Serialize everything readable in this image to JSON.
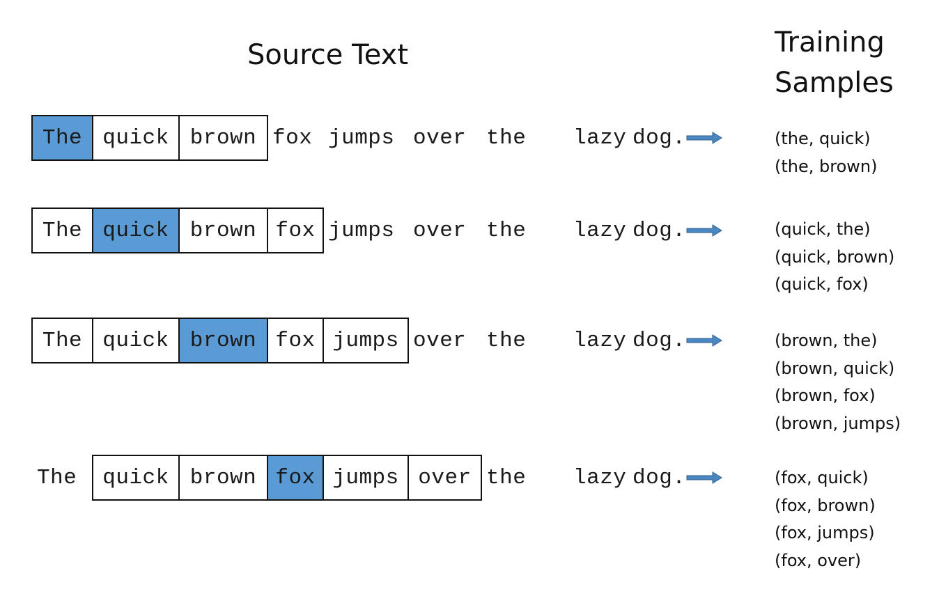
{
  "titles": {
    "source": "Source Text",
    "samples_line1": "Training",
    "samples_line2": "Samples"
  },
  "colors": {
    "target": "#5b9bd5",
    "arrow": "#4a86c0",
    "border": "#111111"
  },
  "words": [
    "The",
    "quick",
    "brown",
    "fox",
    "jumps",
    "over",
    "the",
    "lazy",
    "dog."
  ],
  "rows": [
    {
      "target_index": 0,
      "window": [
        0,
        2
      ],
      "samples": [
        "(the, quick)",
        "(the, brown)"
      ]
    },
    {
      "target_index": 1,
      "window": [
        0,
        3
      ],
      "samples": [
        "(quick, the)",
        "(quick, brown)",
        "(quick, fox)"
      ]
    },
    {
      "target_index": 2,
      "window": [
        0,
        4
      ],
      "samples": [
        "(brown, the)",
        "(brown, quick)",
        "(brown, fox)",
        "(brown, jumps)"
      ]
    },
    {
      "target_index": 3,
      "window": [
        1,
        5
      ],
      "samples": [
        "(fox, quick)",
        "(fox, brown)",
        "(fox, jumps)",
        "(fox, over)"
      ]
    }
  ]
}
